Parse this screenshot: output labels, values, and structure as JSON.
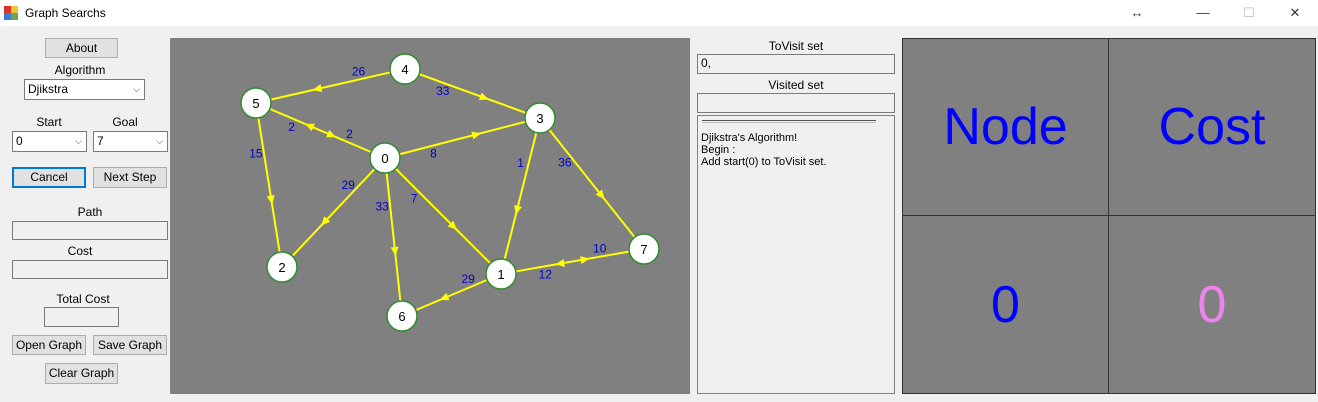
{
  "window": {
    "title": "Graph Searchs",
    "resize_glyph": "↔",
    "minimize_glyph": "—",
    "maximize_glyph": "☐",
    "close_glyph": "✕"
  },
  "left": {
    "about_label": "About",
    "algorithm_label": "Algorithm",
    "algorithm_value": "Djikstra",
    "start_label": "Start",
    "goal_label": "Goal",
    "start_value": "0",
    "goal_value": "7",
    "cancel_label": "Cancel",
    "next_step_label": "Next Step",
    "path_label": "Path",
    "path_value": "",
    "cost_label": "Cost",
    "cost_value": "",
    "total_cost_label": "Total Cost",
    "total_cost_value": "",
    "open_graph_label": "Open Graph",
    "save_graph_label": "Save Graph",
    "clear_graph_label": "Clear Graph"
  },
  "graph": {
    "edge_color": "#ffff00",
    "weight_color": "#0000cc",
    "node_border": "#2e8b2e",
    "nodes": [
      "0",
      "1",
      "2",
      "3",
      "4",
      "5",
      "6",
      "7"
    ],
    "edges": [
      {
        "from": "4",
        "to": "5",
        "weight": "26"
      },
      {
        "from": "4",
        "to": "3",
        "weight": "33"
      },
      {
        "from": "5",
        "to": "0",
        "weight": "2"
      },
      {
        "from": "0",
        "to": "5",
        "weight": "2"
      },
      {
        "from": "5",
        "to": "2",
        "weight": "15"
      },
      {
        "from": "0",
        "to": "3",
        "weight": "8"
      },
      {
        "from": "3",
        "to": "1",
        "weight": "1"
      },
      {
        "from": "3",
        "to": "7",
        "weight": "36"
      },
      {
        "from": "0",
        "to": "2",
        "weight": "29"
      },
      {
        "from": "0",
        "to": "6",
        "weight": "33"
      },
      {
        "from": "0",
        "to": "1",
        "weight": "7"
      },
      {
        "from": "1",
        "to": "6",
        "weight": "29"
      },
      {
        "from": "1",
        "to": "7",
        "weight": "12"
      },
      {
        "from": "7",
        "to": "1",
        "weight": "10"
      }
    ]
  },
  "right": {
    "tovisit_label": "ToVisit set",
    "tovisit_value": "0,",
    "visited_label": "Visited set",
    "visited_value": "",
    "log_text": "Djikstra's Algorithm!\nBegin :\nAdd start(0) to ToVisit set."
  },
  "table": {
    "header_node": "Node",
    "header_cost": "Cost",
    "value_node": "0",
    "value_cost": "0",
    "header_color": "#0000ff",
    "node_value_color": "#0000ff",
    "cost_value_color": "#ee82ee"
  }
}
